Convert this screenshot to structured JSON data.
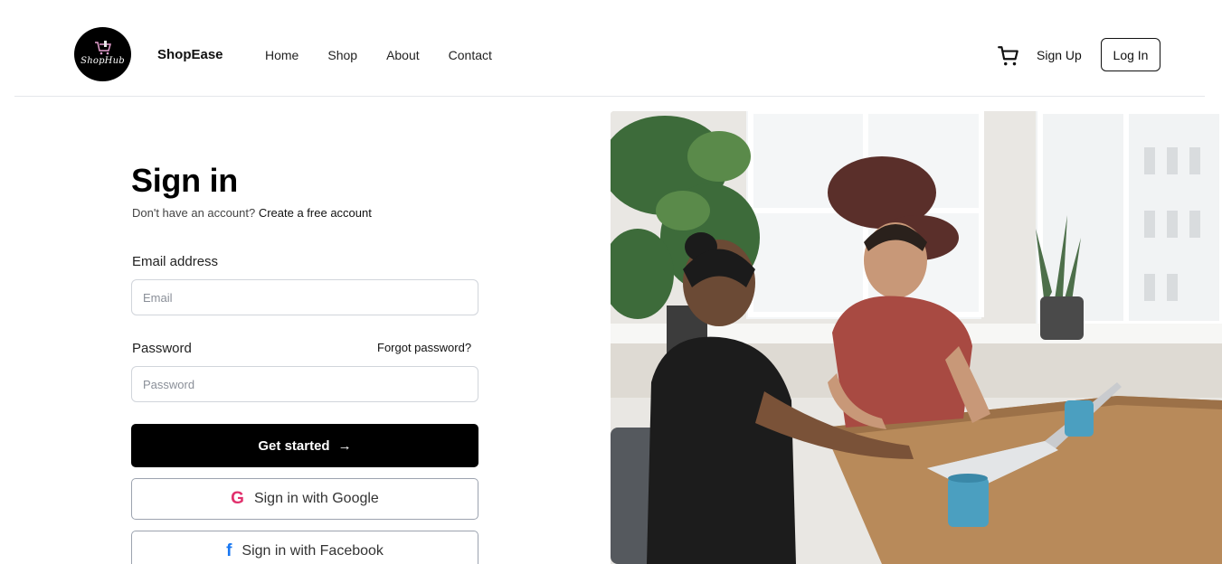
{
  "header": {
    "logo_text": "ShopHub",
    "brand": "ShopEase",
    "nav": [
      "Home",
      "Shop",
      "About",
      "Contact"
    ],
    "cart_icon": "cart-icon",
    "signup_label": "Sign Up",
    "login_label": "Log In"
  },
  "form": {
    "title": "Sign in",
    "subtitle_text": "Don't have an account?",
    "subtitle_link": "Create a free account",
    "email_label": "Email address",
    "email_placeholder": "Email",
    "email_value": "",
    "password_label": "Password",
    "forgot_label": "Forgot password?",
    "password_placeholder": "Password",
    "password_value": "",
    "primary_label": "Get started",
    "primary_icon": "arrow-right-icon",
    "google_label": "Sign in with Google",
    "google_icon": "google-icon",
    "facebook_label": "Sign in with Facebook",
    "facebook_icon": "facebook-icon"
  },
  "colors": {
    "primary": "#000000",
    "google": "#e1306c",
    "facebook": "#1877f2",
    "border": "#d1d5db"
  }
}
